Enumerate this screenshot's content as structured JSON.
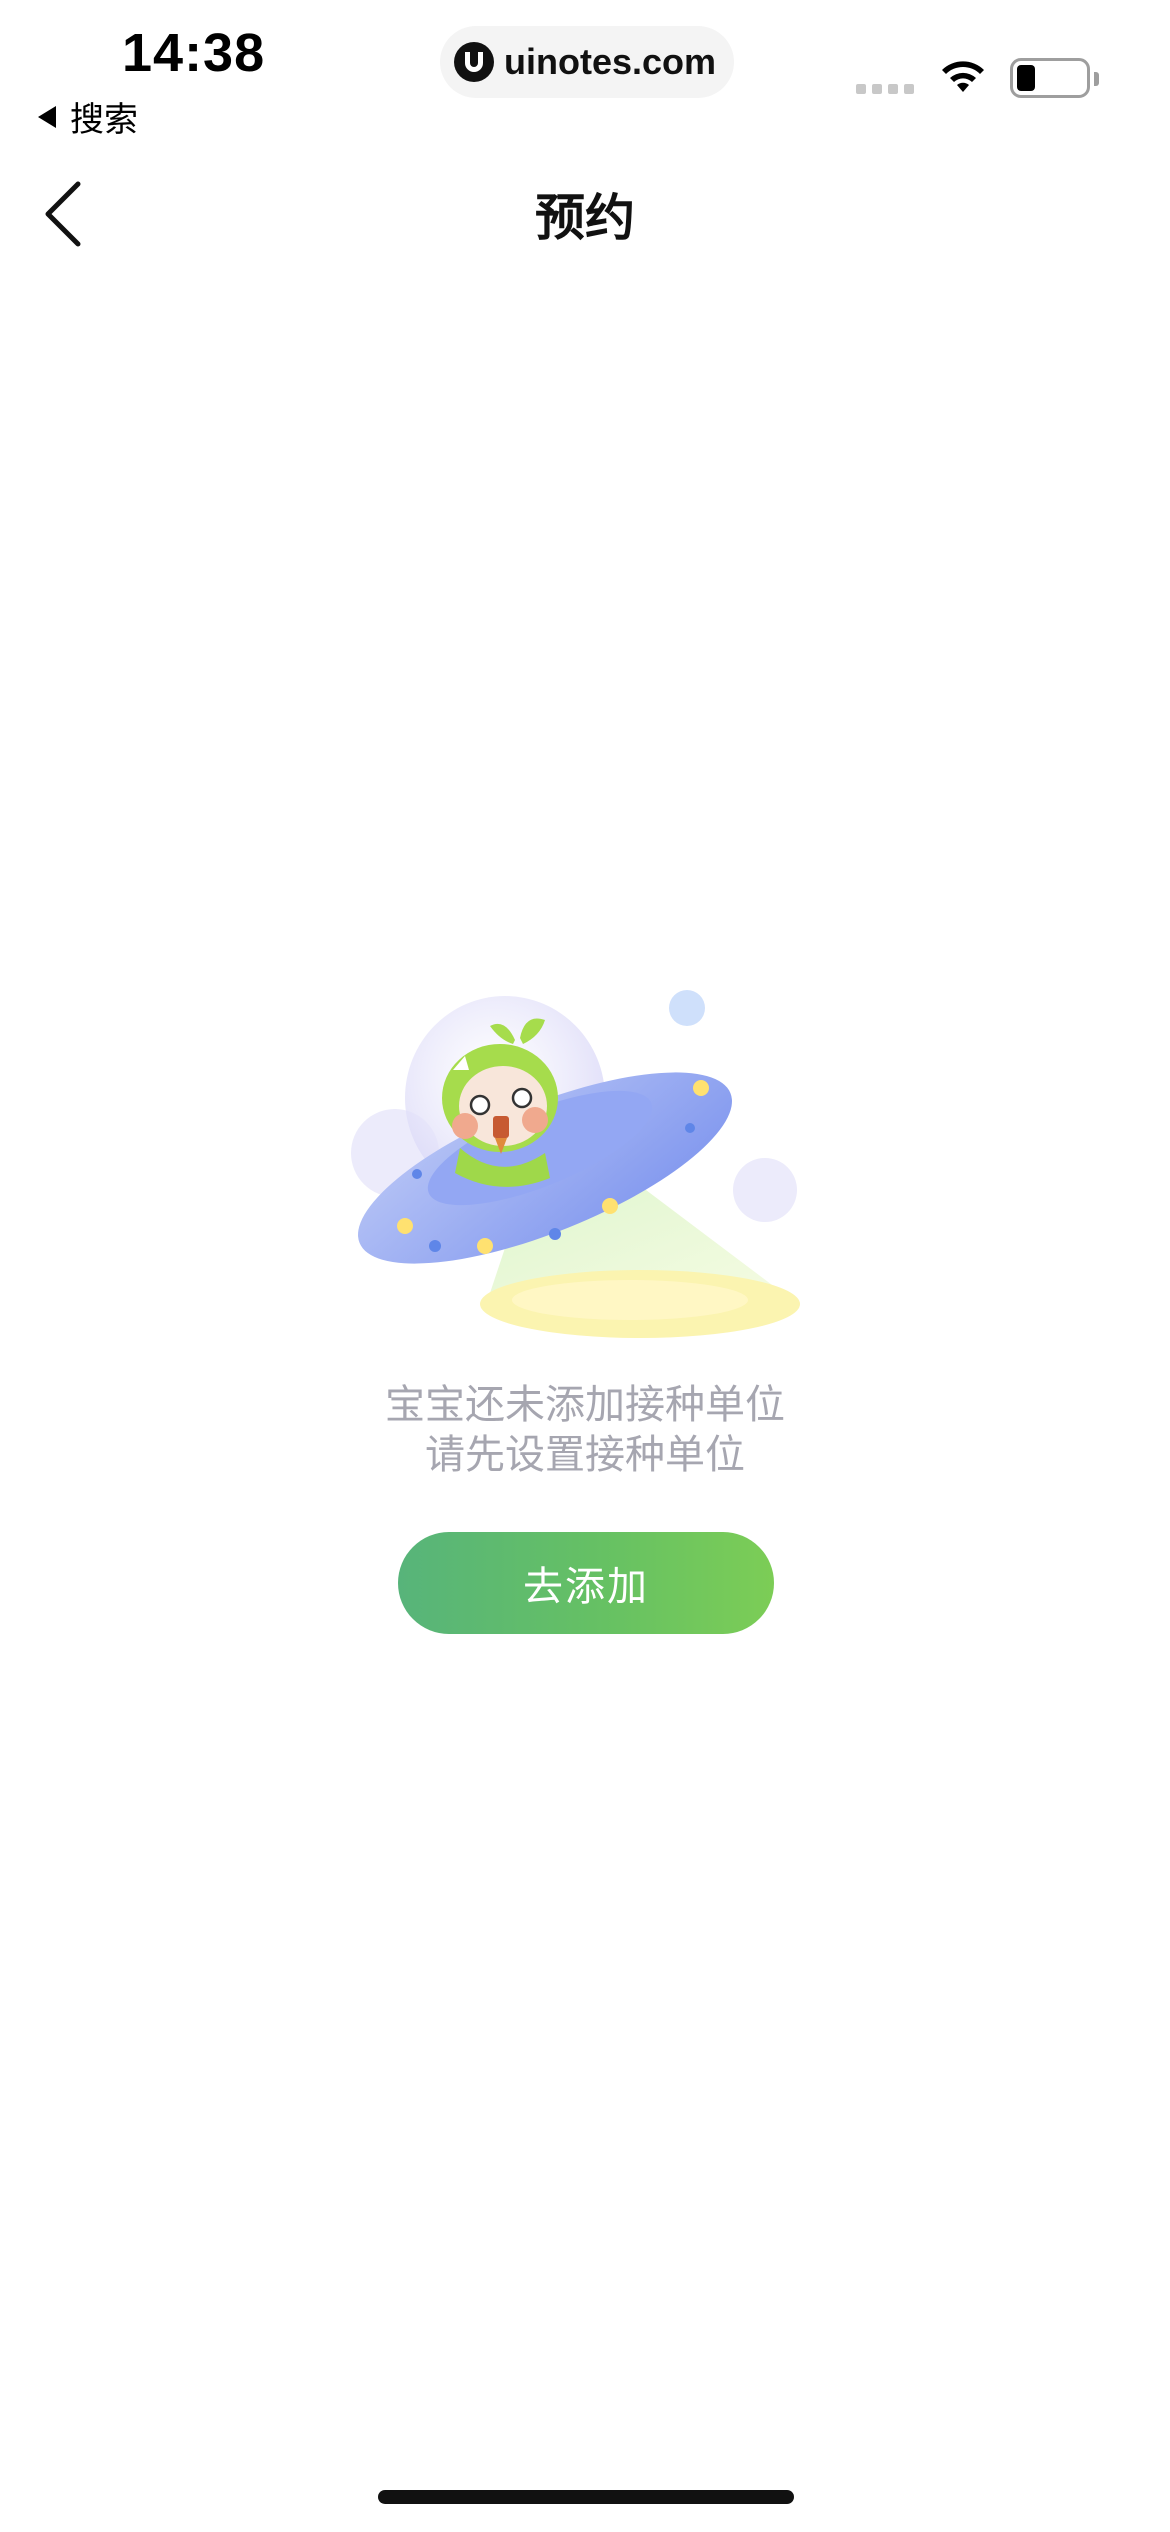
{
  "status_bar": {
    "time": "14:38",
    "back_app_label": "搜索",
    "url": "uinotes.com",
    "icons": [
      "signal-icon",
      "wifi-icon",
      "battery-icon"
    ]
  },
  "nav": {
    "back_icon": "chevron-left-icon",
    "title": "预约"
  },
  "empty_state": {
    "illustration": "ufo-mascot-illustration",
    "line1": "宝宝还未添加接种单位",
    "line2": "请先设置接种单位",
    "button_label": "去添加"
  },
  "colors": {
    "button_gradient_start": "#57b47a",
    "button_gradient_end": "#7ccd56",
    "hint_text": "#a6a6b0",
    "ufo_blue": "#8fa6f2",
    "mascot_green": "#9fd84a"
  }
}
